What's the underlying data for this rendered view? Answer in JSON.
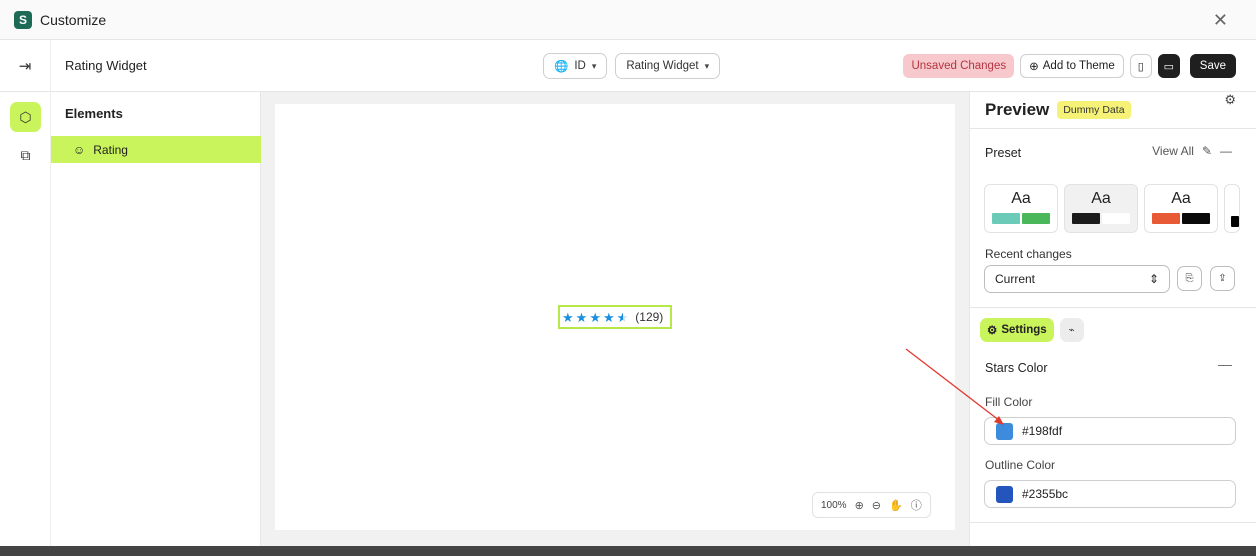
{
  "window": {
    "title": "Customize"
  },
  "header": {
    "widget_name": "Rating Widget",
    "language": "ID",
    "widget_select": "Rating Widget",
    "unsaved": "Unsaved Changes",
    "add_to_theme": "Add to Theme",
    "save": "Save"
  },
  "elements": {
    "title": "Elements",
    "items": [
      {
        "label": "Rating"
      }
    ]
  },
  "canvas": {
    "rating": {
      "value": 4.5,
      "max": 5,
      "count": "(129)",
      "star_color": "#198fdf"
    },
    "zoom": "100%"
  },
  "panel": {
    "title": "Preview",
    "badge": "Dummy Data",
    "preset_label": "Preset",
    "view_all": "View All",
    "presets": [
      {
        "label": "Aa",
        "colors": [
          "#6ccbb8",
          "#4ab85a"
        ]
      },
      {
        "label": "Aa",
        "colors": [
          "#1b1b1b",
          "#ffffff"
        ]
      },
      {
        "label": "Aa",
        "colors": [
          "#e85a36",
          "#0a0a0a"
        ]
      },
      {
        "label": "",
        "colors": [
          "#000000"
        ]
      }
    ],
    "recent_label": "Recent changes",
    "recent_value": "Current",
    "settings_tab": "Settings",
    "section_title": "Stars Color",
    "fill_label": "Fill Color",
    "fill_value": "#198fdf",
    "outline_label": "Outline Color",
    "outline_value": "#2355bc"
  },
  "colors": {
    "accent": "#c9f45b",
    "annotation_arrow": "#e03a2f"
  }
}
